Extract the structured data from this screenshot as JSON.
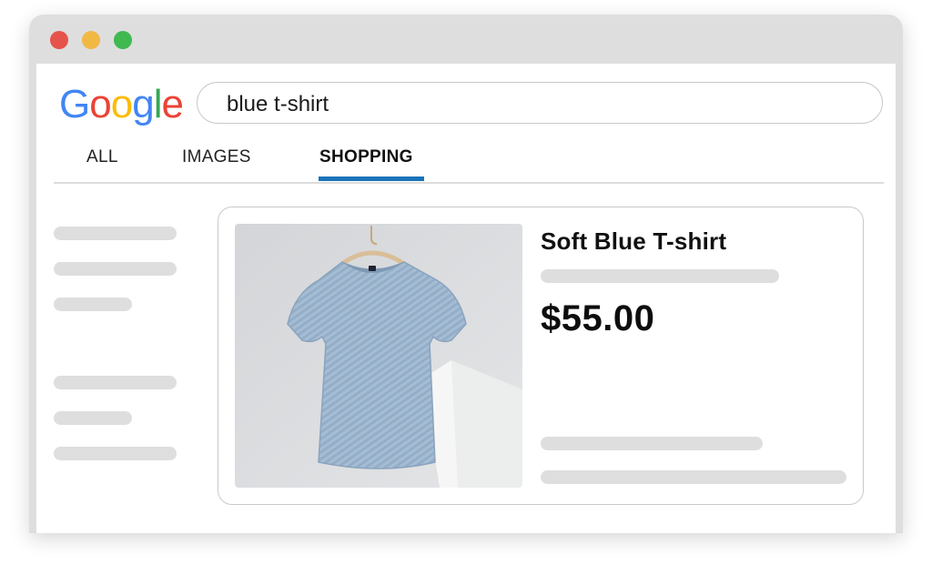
{
  "browser": {
    "window_controls": [
      "close",
      "minimize",
      "maximize"
    ]
  },
  "search": {
    "logo_letters": [
      {
        "char": "G",
        "color": "#4285F4"
      },
      {
        "char": "o",
        "color": "#EA4335"
      },
      {
        "char": "o",
        "color": "#FBBC05"
      },
      {
        "char": "g",
        "color": "#4285F4"
      },
      {
        "char": "l",
        "color": "#34A853"
      },
      {
        "char": "e",
        "color": "#EA4335"
      }
    ],
    "query": "blue t-shirt"
  },
  "tabs": {
    "all": "ALL",
    "images": "IMAGES",
    "shopping": "SHOPPING",
    "active": "SHOPPING",
    "active_color": "#1a73b8"
  },
  "product": {
    "title": "Soft Blue T-shirt",
    "price": "$55.00",
    "image_icon": "blue-tshirt-on-hanger"
  }
}
